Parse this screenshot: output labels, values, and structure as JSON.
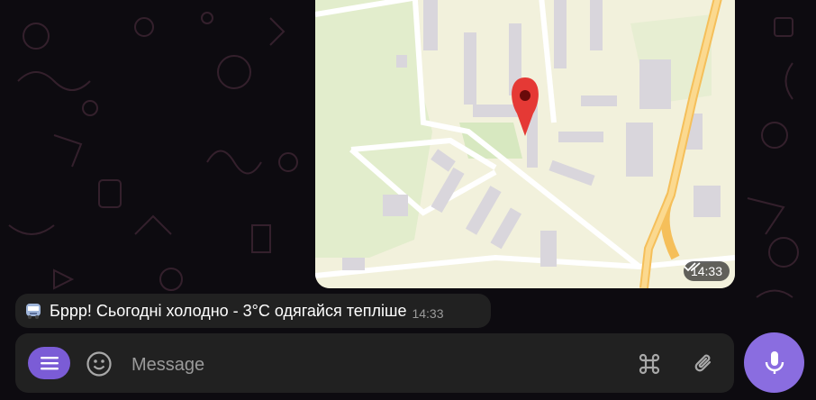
{
  "chat": {
    "map_message": {
      "time": "14:33",
      "status_icon": "double-check-icon"
    },
    "text_message": {
      "icon": "bus-icon",
      "text": "Бррр! Сьогодні холодно - 3°С одягайся тепліше",
      "time": "14:33"
    }
  },
  "composer": {
    "placeholder": "Message",
    "menu_icon": "menu-icon",
    "emoji_icon": "smile-icon",
    "command_icon": "command-icon",
    "attach_icon": "paperclip-icon",
    "mic_icon": "microphone-icon"
  },
  "colors": {
    "accent": "#8a6de0",
    "bubble": "#212121",
    "map_pin": "#e53935",
    "road": "#f7c873"
  }
}
